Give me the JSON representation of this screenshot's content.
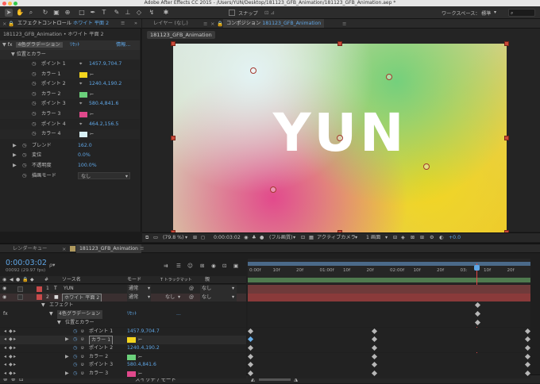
{
  "titlebar": {
    "text": "Adobe After Effects CC 2015 - /Users/YUN/Desktop/181123_GFB_Animation/181123_GFB_Animation.aep *"
  },
  "toolbar": {
    "snap_label": "スナップ",
    "workspace_label": "ワークスペース：",
    "workspace_value": "標準"
  },
  "effects_panel": {
    "tab_title": "エフェクトコントロール",
    "tab_layer": "ホワイト 平面 2",
    "breadcrumb": "181123_GFB_Animation • ホワイト 平面 2",
    "effect_name": "4色グラデーション",
    "reset_label": "ﾘｾｯﾄ",
    "about_label": "情報...",
    "group_label": "位置とカラー",
    "params": [
      {
        "label": "ポイント 1",
        "value": "1457.9,704.7",
        "kind": "point"
      },
      {
        "label": "カラー 1",
        "value": "",
        "kind": "color",
        "color": "#f4d51e"
      },
      {
        "label": "ポイント 2",
        "value": "1240.4,190.2",
        "kind": "point"
      },
      {
        "label": "カラー 2",
        "value": "",
        "kind": "color",
        "color": "#6bd07b"
      },
      {
        "label": "ポイント 3",
        "value": "580.4,841.6",
        "kind": "point"
      },
      {
        "label": "カラー 3",
        "value": "",
        "kind": "color",
        "color": "#e0488b"
      },
      {
        "label": "ポイント 4",
        "value": "464.2,156.5",
        "kind": "point"
      },
      {
        "label": "カラー 4",
        "value": "",
        "kind": "color",
        "color": "#d8f1f6"
      }
    ],
    "extras": [
      {
        "label": "ブレンド",
        "value": "162.0"
      },
      {
        "label": "変位",
        "value": "0.0%"
      },
      {
        "label": "不透明度",
        "value": "100.0%"
      },
      {
        "label": "描画モード",
        "value": "なし"
      }
    ]
  },
  "comp_panel": {
    "layer_tab": "レイヤー (なし)",
    "comp_tab_prefix": "コンポジション",
    "comp_tab_name": "181123_GFB_Animation",
    "sub_tab": "181123_GFB_Animation",
    "canvas_text": "YUN",
    "zoom": "(79.8 %)",
    "timecode": "0:00:03:02",
    "resolution": "(フル画質)",
    "camera": "アクティブカメラ",
    "views": "1 画面",
    "exposure": "+0.0"
  },
  "timeline": {
    "render_tab": "レンダーキュー",
    "comp_tab": "181123_GFB_Animation",
    "timecode": "0:00:03:02",
    "frame_info": "00092 (29.97 fps)",
    "search_placeholder": "ρ▾",
    "col_hash": "#",
    "col_source": "ソース名",
    "col_mode": "モード",
    "col_trkmat": "T トラックマット",
    "col_parent": "親",
    "ruler": [
      "0:00f",
      "10f",
      "20f",
      "01:00f",
      "10f",
      "20f",
      "02:00f",
      "10f",
      "20f",
      "03:",
      "10f",
      "20f"
    ],
    "layers": [
      {
        "num": "1",
        "name": "YUN",
        "mode": "通常",
        "trkmat": "",
        "parent": "なし",
        "color": "#c84a4a"
      },
      {
        "num": "2",
        "name": "ホワイト 平面 2",
        "mode": "通常",
        "trkmat": "なし",
        "parent": "なし",
        "color": "#c84a4a"
      }
    ],
    "effects_label": "エフェクト",
    "effect_name": "4色グラデーション",
    "reset_label": "ﾘｾｯﾄ",
    "dots": "...",
    "group_label": "位置とカラー",
    "props": [
      {
        "label": "ポイント 1",
        "value": "1457.9,704.7"
      },
      {
        "label": "カラー 1",
        "value": ""
      },
      {
        "label": "ポイント 2",
        "value": "1240.4,190.2"
      },
      {
        "label": "カラー 2",
        "value": ""
      },
      {
        "label": "ポイント 3",
        "value": "580.4,841.6"
      },
      {
        "label": "カラー 3",
        "value": ""
      }
    ],
    "switch_mode_label": "スイッチ / モード"
  }
}
